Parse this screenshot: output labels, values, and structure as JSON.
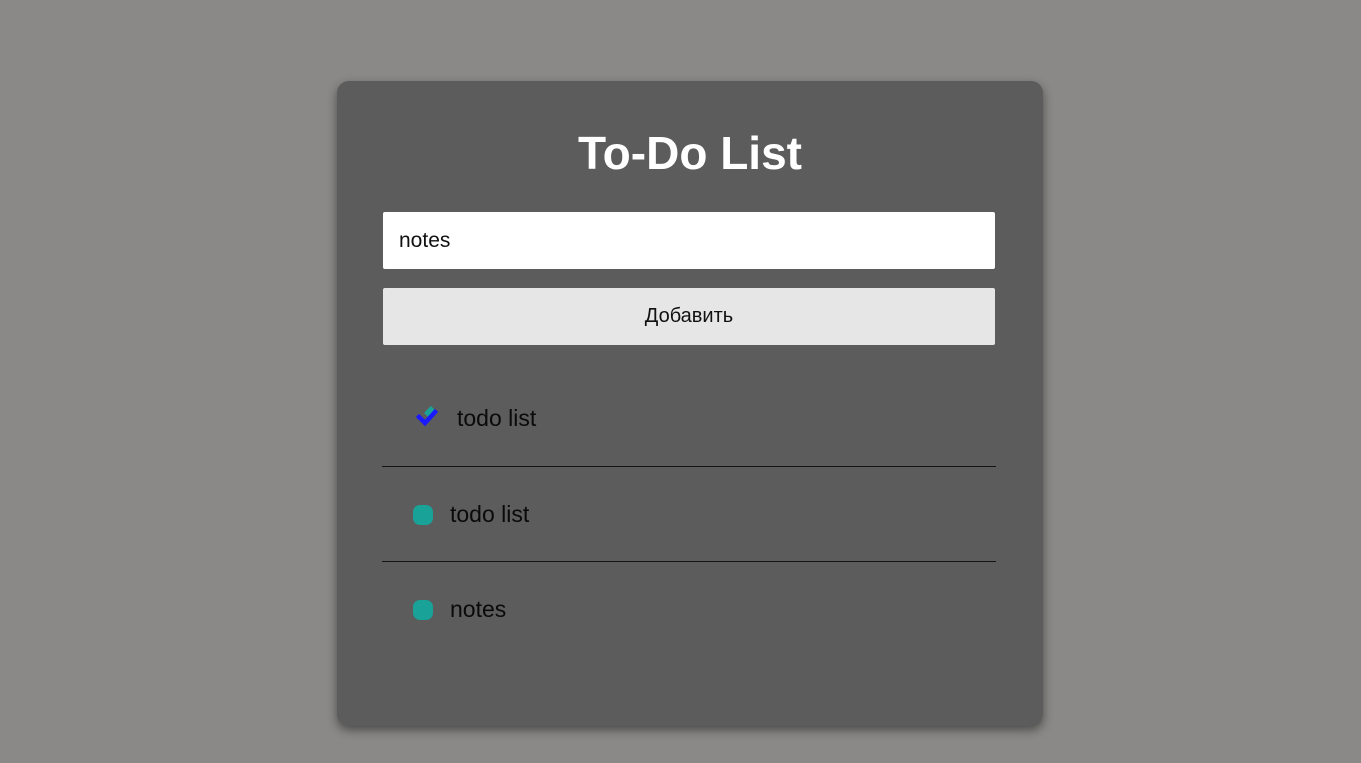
{
  "app": {
    "title": "To-Do List"
  },
  "input": {
    "value": "notes",
    "placeholder": ""
  },
  "add_button": {
    "label": "Добавить"
  },
  "tasks": [
    {
      "text": "todo list",
      "completed": true,
      "icon": "checkmark-icon"
    },
    {
      "text": "todo list",
      "completed": false,
      "icon": "circle-icon"
    },
    {
      "text": "notes",
      "completed": false,
      "icon": "circle-icon"
    }
  ],
  "colors": {
    "background": "#8a8987",
    "card": "#5c5c5c",
    "accent": "#18a298",
    "check_blue": "#1a1aff",
    "divider": "#141414"
  }
}
